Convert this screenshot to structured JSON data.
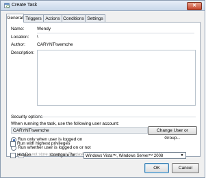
{
  "window": {
    "title": "Create Task",
    "close_glyph": "✕"
  },
  "tabs": [
    {
      "label": "General",
      "active": true
    },
    {
      "label": "Triggers",
      "active": false
    },
    {
      "label": "Actions",
      "active": false
    },
    {
      "label": "Conditions",
      "active": false
    },
    {
      "label": "Settings",
      "active": false
    }
  ],
  "general": {
    "name_label": "Name:",
    "name_value": "Wendy",
    "location_label": "Location:",
    "location_value": "\\",
    "author_label": "Author:",
    "author_value": "CARYNT\\wemche",
    "description_label": "Description:"
  },
  "security": {
    "title": "Security options",
    "account_prompt": "When running the task, use the following user account:",
    "account_value": "CARYNT\\wemche",
    "change_button": "Change User or Group...",
    "radio_logged_on": "Run only when user is logged on",
    "radio_logged_on_selected": true,
    "radio_either": "Run whether user is logged on or not",
    "no_password": "Do not store password. The task will only have access to local computer resources.",
    "highest_privileges": "Run with highest privileges"
  },
  "footer": {
    "hidden_label": "Hidden",
    "configure_label": "Configure for:",
    "configure_value": "Windows Vista™, Windows Server™ 2008",
    "ok_button": "OK",
    "cancel_button": "Cancel"
  }
}
